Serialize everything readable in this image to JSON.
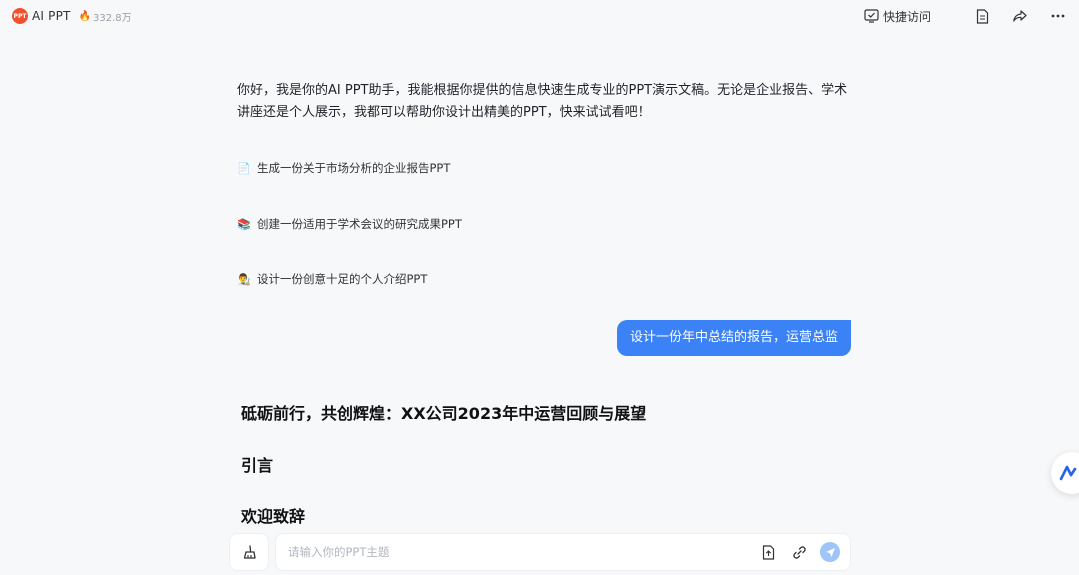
{
  "header": {
    "logo_text": "PPT",
    "app_title": "AI PPT",
    "hot_count": "332.8万",
    "quick_access_label": "快捷访问"
  },
  "chat": {
    "intro": "你好，我是你的AI PPT助手，我能根据你提供的信息快速生成专业的PPT演示文稿。无论是企业报告、学术讲座还是个人展示，我都可以帮助你设计出精美的PPT，快来试试看吧！",
    "suggestions": [
      {
        "emoji": "📄",
        "label": "生成一份关于市场分析的企业报告PPT"
      },
      {
        "emoji": "📚",
        "label": "创建一份适用于学术会议的研究成果PPT"
      },
      {
        "emoji": "👨‍🎨",
        "label": "设计一份创意十足的个人介绍PPT"
      }
    ],
    "user_message": "设计一份年中总结的报告，运营总监",
    "answer": {
      "title": "砥砺前行，共创辉煌：XX公司2023年中运营回顾与展望",
      "section1": "引言",
      "section2": "欢迎致辞"
    }
  },
  "input": {
    "placeholder": "请输入你的PPT主题"
  },
  "colors": {
    "accent": "#3b82f6",
    "send_disabled": "#9fc4f8",
    "logo": "#f0522d"
  }
}
